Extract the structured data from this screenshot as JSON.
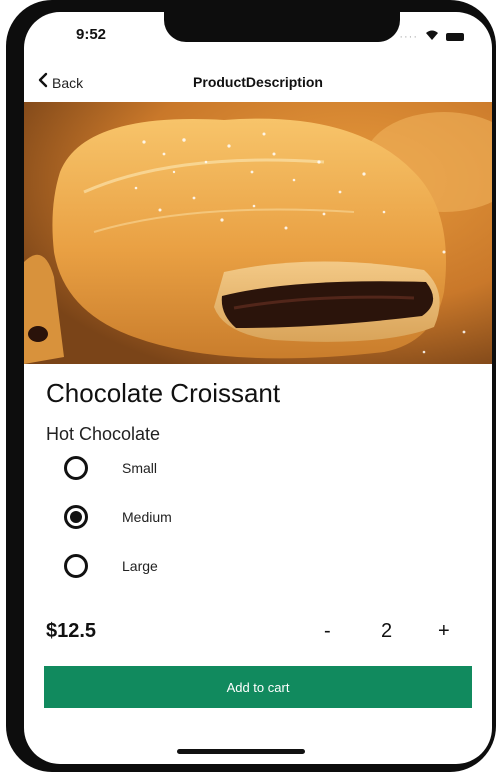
{
  "status_bar": {
    "time": "9:52",
    "signal_icon": "signal-icon",
    "wifi_icon": "wifi-icon",
    "battery_icon": "battery-icon"
  },
  "nav": {
    "back_label": "Back",
    "title": "ProductDescription",
    "back_icon": "chevron-left-icon"
  },
  "product": {
    "image_subject": "chocolate croissant photo",
    "title": "Chocolate Croissant",
    "subtitle": "Hot Chocolate",
    "price": "$12.5"
  },
  "size_options": [
    {
      "label": "Small",
      "selected": false
    },
    {
      "label": "Medium",
      "selected": true
    },
    {
      "label": "Large",
      "selected": false
    }
  ],
  "quantity": {
    "minus_label": "-",
    "value": "2",
    "plus_label": "+"
  },
  "cart": {
    "add_label": "Add to cart"
  },
  "colors": {
    "accent": "#118a5e",
    "frame": "#0d0d0d"
  }
}
